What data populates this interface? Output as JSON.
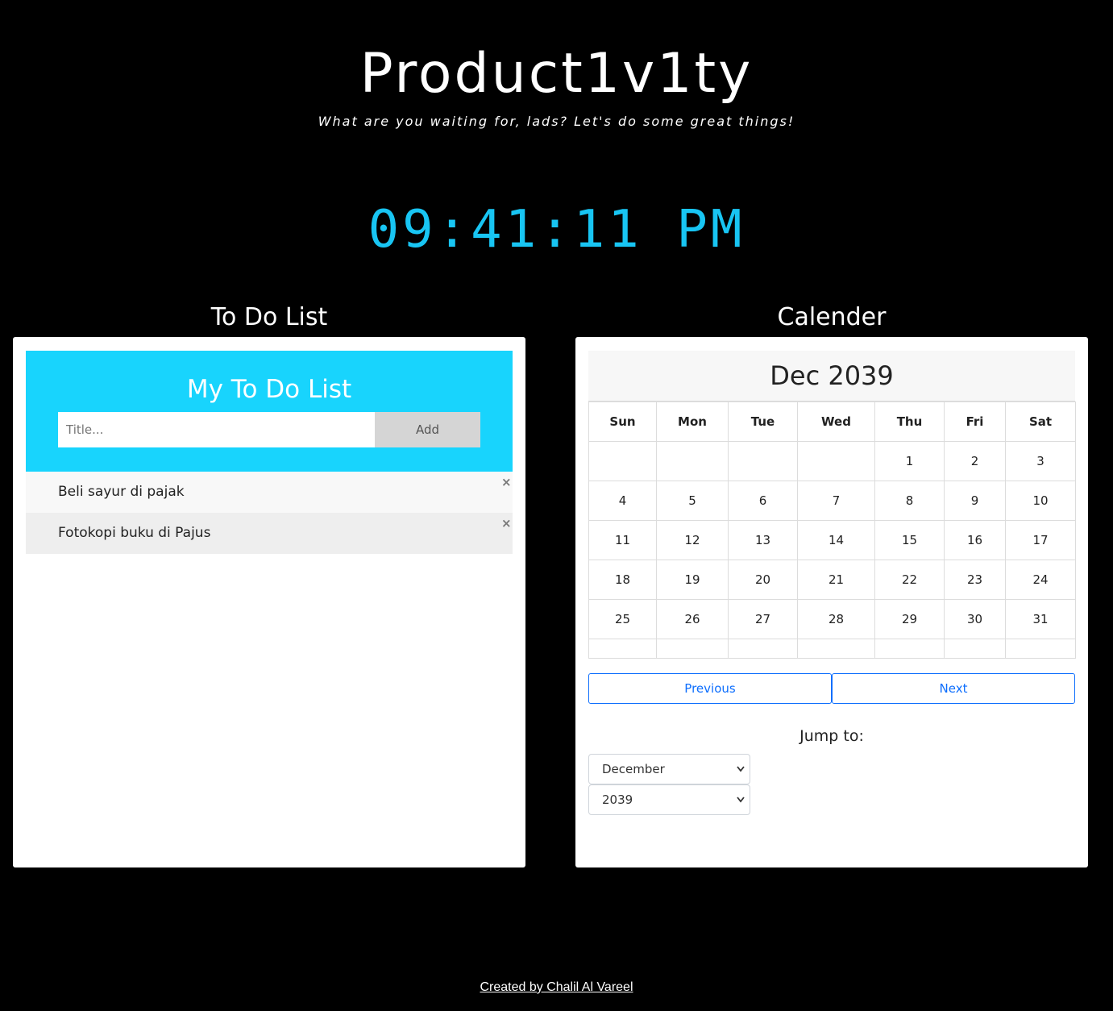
{
  "header": {
    "title": "Product1v1ty",
    "subtitle": "What are you waiting for, lads? Let's do some great things!"
  },
  "clock": {
    "time": "09:41:11 PM",
    "color": "#18c5f3"
  },
  "todo_section": {
    "heading": "To Do List",
    "list_title": "My To Do List",
    "input": {
      "value": "",
      "placeholder": "Title..."
    },
    "add_label": "Add",
    "items": [
      {
        "text": "Beli sayur di pajak",
        "close": "×"
      },
      {
        "text": "Fotokopi buku di Pajus",
        "close": "×"
      }
    ],
    "header_color": "#18d4fd"
  },
  "calendar_section": {
    "heading": "Calender",
    "month_year": "Dec 2039",
    "weekdays": [
      "Sun",
      "Mon",
      "Tue",
      "Wed",
      "Thu",
      "Fri",
      "Sat"
    ],
    "weeks": [
      [
        "",
        "",
        "",
        "",
        "1",
        "2",
        "3"
      ],
      [
        "4",
        "5",
        "6",
        "7",
        "8",
        "9",
        "10"
      ],
      [
        "11",
        "12",
        "13",
        "14",
        "15",
        "16",
        "17"
      ],
      [
        "18",
        "19",
        "20",
        "21",
        "22",
        "23",
        "24"
      ],
      [
        "25",
        "26",
        "27",
        "28",
        "29",
        "30",
        "31"
      ],
      [
        "",
        "",
        "",
        "",
        "",
        "",
        ""
      ]
    ],
    "previous_label": "Previous",
    "next_label": "Next",
    "jump_label": "Jump to:",
    "month_select": "December",
    "year_select": "2039",
    "button_color": "#0d6efd"
  },
  "footer": {
    "credit": "Created by Chalil Al Vareel"
  }
}
